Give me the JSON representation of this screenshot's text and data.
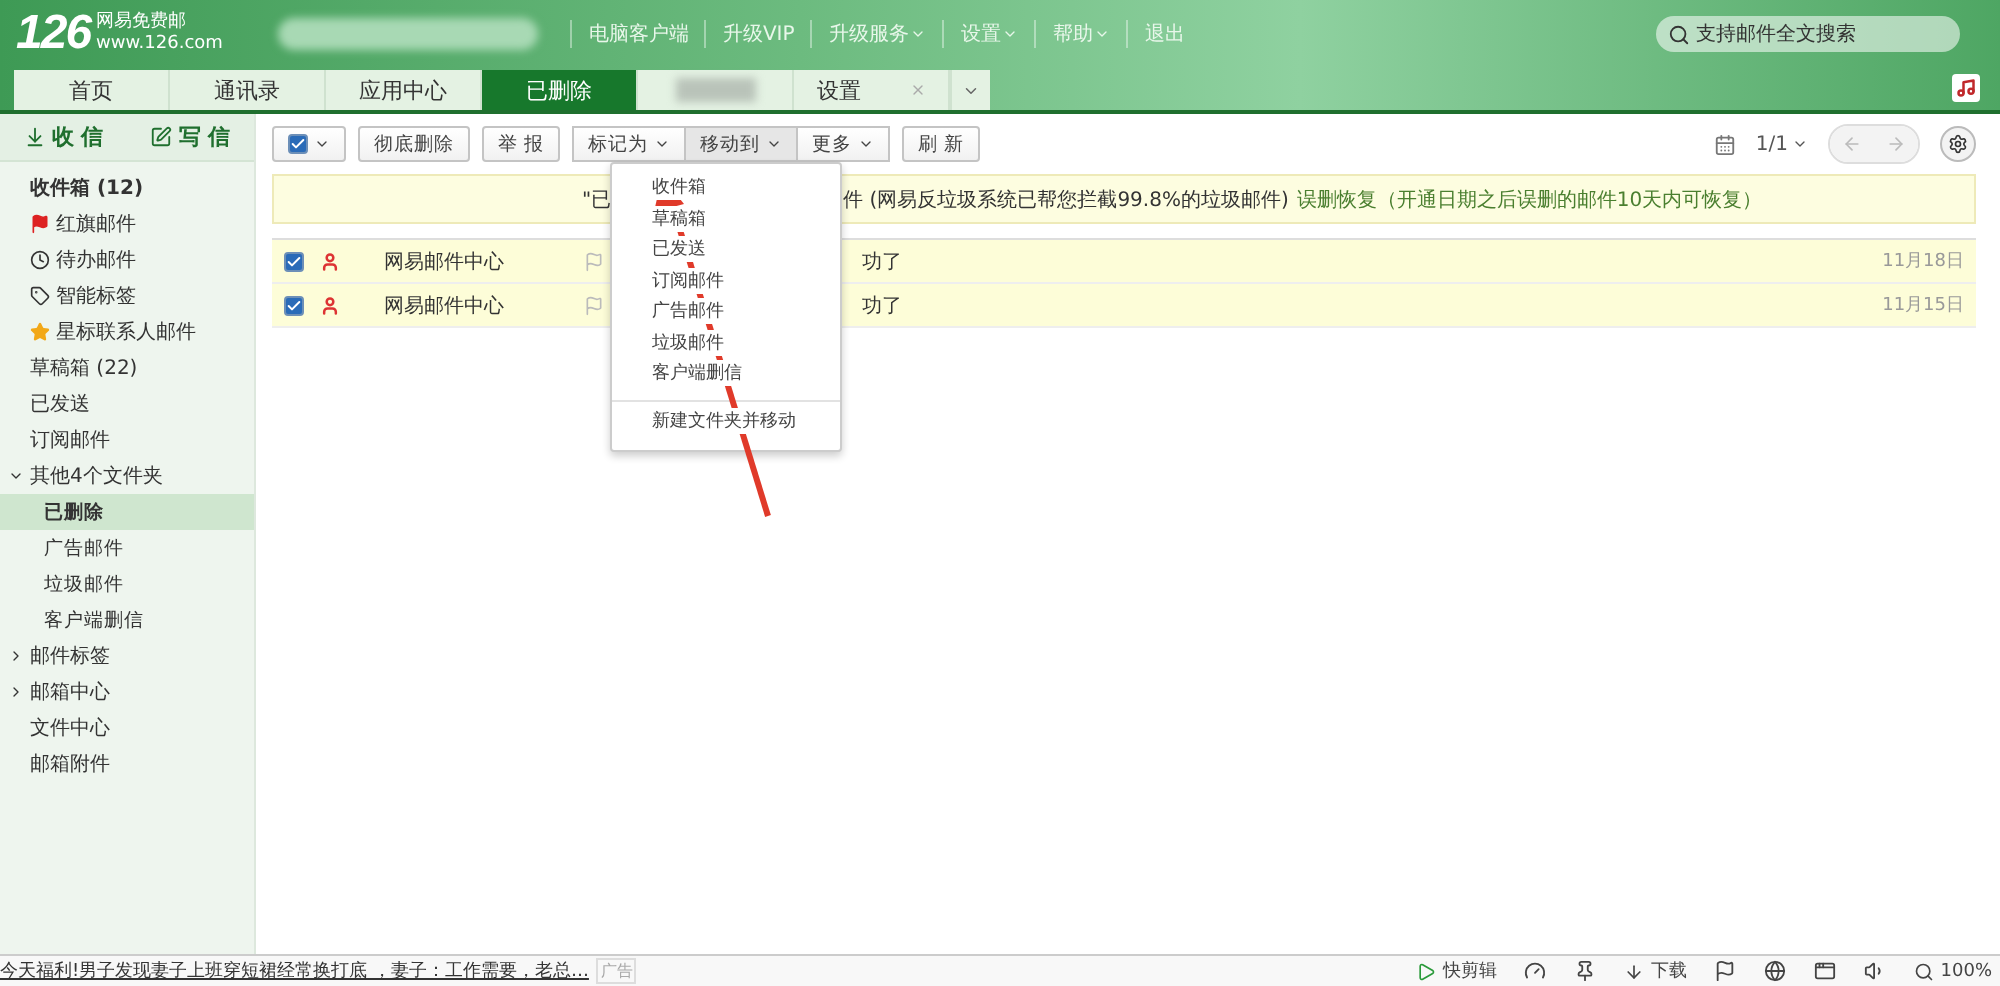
{
  "logo": {
    "number": "126",
    "name": "网易免费邮",
    "url": "www.126.com"
  },
  "top_links": [
    {
      "label": "电脑客户端",
      "dropdown": false
    },
    {
      "label": "升级VIP",
      "dropdown": false
    },
    {
      "label": "升级服务",
      "dropdown": true
    },
    {
      "label": "设置",
      "dropdown": true
    },
    {
      "label": "帮助",
      "dropdown": true
    },
    {
      "label": "退出",
      "dropdown": false
    }
  ],
  "search": {
    "placeholder": "支持邮件全文搜索"
  },
  "tabs": [
    {
      "kind": "plain",
      "label": "首页",
      "selected": false
    },
    {
      "kind": "plain",
      "label": "通讯录",
      "selected": false
    },
    {
      "kind": "plain",
      "label": "应用中心",
      "selected": false
    },
    {
      "kind": "plain",
      "label": "已删除",
      "selected": true
    },
    {
      "kind": "blurred",
      "selected": false
    },
    {
      "kind": "closable",
      "label": "设置",
      "selected": false
    }
  ],
  "sidebar": {
    "actions": [
      {
        "kind": "receive",
        "label": "收 信"
      },
      {
        "kind": "compose",
        "label": "写 信"
      }
    ],
    "items": [
      {
        "kind": "folder",
        "label": "收件箱 (12)",
        "bold": true,
        "selected": false
      },
      {
        "kind": "flagged",
        "label": "红旗邮件",
        "bold": false,
        "selected": false
      },
      {
        "kind": "todo",
        "label": "待办邮件",
        "bold": false,
        "selected": false
      },
      {
        "kind": "smart_tag",
        "label": "智能标签",
        "bold": false,
        "selected": false
      },
      {
        "kind": "starred",
        "label": "星标联系人邮件",
        "bold": false,
        "selected": false
      },
      {
        "kind": "folder",
        "label": "草稿箱 (22)",
        "bold": false,
        "selected": false
      },
      {
        "kind": "folder",
        "label": "已发送",
        "bold": false,
        "selected": false
      },
      {
        "kind": "folder",
        "label": "订阅邮件",
        "bold": false,
        "selected": false
      },
      {
        "kind": "folder",
        "label": "其他4个文件夹",
        "bold": false,
        "selected": false,
        "expanded": true,
        "children": [
          {
            "label": "已删除",
            "selected": true
          },
          {
            "label": "广告邮件",
            "selected": false
          },
          {
            "label": "垃圾邮件",
            "selected": false
          },
          {
            "label": "客户端删信",
            "selected": false
          }
        ]
      },
      {
        "kind": "folder",
        "label": "邮件标签",
        "bold": false,
        "selected": false,
        "expanded": false
      },
      {
        "kind": "folder",
        "label": "邮箱中心",
        "bold": false,
        "selected": false,
        "expanded": false
      },
      {
        "kind": "folder",
        "label": "文件中心",
        "bold": false,
        "selected": false
      },
      {
        "kind": "folder",
        "label": "邮箱附件",
        "bold": false,
        "selected": false
      }
    ]
  },
  "toolbar": {
    "select_all": {
      "checked": true
    },
    "buttons": [
      {
        "label": "彻底删除",
        "dropdown": false,
        "group": false,
        "pressed": false
      },
      {
        "label": "举 报",
        "dropdown": false,
        "group": false,
        "pressed": false
      },
      {
        "label": "标记为",
        "dropdown": true,
        "group": true,
        "pressed": false
      },
      {
        "label": "移动到",
        "dropdown": true,
        "group": true,
        "pressed": true
      },
      {
        "label": "更多",
        "dropdown": true,
        "group": true,
        "pressed": false
      },
      {
        "label": "刷 新",
        "dropdown": false,
        "group": false,
        "pressed": false
      }
    ],
    "pager": "1/1"
  },
  "notice": {
    "left": "\"已",
    "right": "件 (网易反垃圾系统已帮您拦截99.8%的垃圾邮件)",
    "link": "误删恢复（开通日期之后误删的邮件10天内可恢复）"
  },
  "mails": [
    {
      "checked": true,
      "sender": "网易邮件中心",
      "subject": "功了",
      "date": "11月18日"
    },
    {
      "checked": true,
      "sender": "网易邮件中心",
      "subject": "功了",
      "date": "11月15日"
    }
  ],
  "move_menu": [
    {
      "kind": "folder",
      "label": "收件箱"
    },
    {
      "kind": "folder",
      "label": "草稿箱"
    },
    {
      "kind": "folder",
      "label": "已发送"
    },
    {
      "kind": "folder",
      "label": "订阅邮件"
    },
    {
      "kind": "folder",
      "label": "广告邮件"
    },
    {
      "kind": "folder",
      "label": "垃圾邮件"
    },
    {
      "kind": "folder",
      "label": "客户端删信"
    },
    {
      "kind": "action",
      "label": "新建文件夹并移动"
    }
  ],
  "status_bar": {
    "news": "今天福利!男子发现妻子上班穿短裙经常换打底 ，妻子：工作需要，老总…",
    "ad": "广告",
    "tools": [
      {
        "kind": "clip",
        "label": "快剪辑"
      },
      {
        "kind": "speed"
      },
      {
        "kind": "pin"
      },
      {
        "kind": "download",
        "label": "下载"
      },
      {
        "kind": "feedback"
      },
      {
        "kind": "browser"
      },
      {
        "kind": "window"
      },
      {
        "kind": "sound"
      },
      {
        "kind": "zoom",
        "label": "100%"
      }
    ]
  }
}
